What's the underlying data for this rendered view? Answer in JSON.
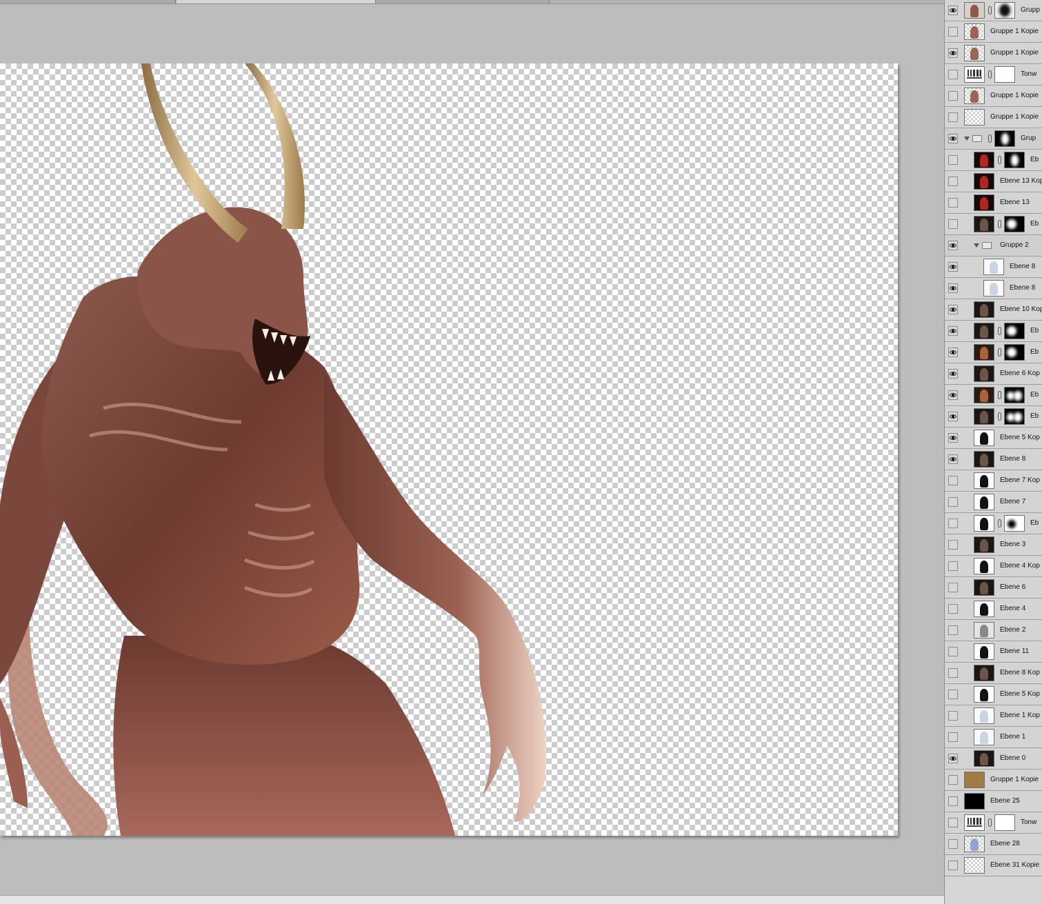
{
  "tabs": [
    {
      "label": "",
      "active": false
    },
    {
      "label": "",
      "active": true
    },
    {
      "label": "",
      "active": false
    }
  ],
  "layers": [
    {
      "name": "Grupp",
      "visible": true,
      "thumb": "creature",
      "mask": "dark",
      "indent": 0
    },
    {
      "name": "Gruppe 1 Kopie",
      "visible": false,
      "thumb": "creature-checker",
      "indent": 0
    },
    {
      "name": "Gruppe 1 Kopie",
      "visible": true,
      "thumb": "creature-checker",
      "indent": 0
    },
    {
      "name": "Tonw",
      "visible": false,
      "thumb": "levels",
      "mask": "white",
      "indent": 0
    },
    {
      "name": "Gruppe 1 Kopie",
      "visible": false,
      "thumb": "creature-checker",
      "indent": 0
    },
    {
      "name": "Gruppe 1 Kopie",
      "visible": false,
      "thumb": "checker",
      "indent": 0
    },
    {
      "name": "Grup",
      "visible": true,
      "group": true,
      "mask": "figure",
      "indent": 0
    },
    {
      "name": "Eb",
      "visible": false,
      "thumb": "red",
      "mask": "figure",
      "indent": 1
    },
    {
      "name": "Ebene 13 Kop",
      "visible": false,
      "thumb": "red",
      "indent": 1
    },
    {
      "name": "Ebene 13",
      "visible": false,
      "thumb": "red",
      "indent": 1
    },
    {
      "name": "Eb",
      "visible": false,
      "thumb": "dark",
      "mask": "blob",
      "indent": 1
    },
    {
      "name": "Gruppe 2",
      "visible": true,
      "group": true,
      "indent": 1
    },
    {
      "name": "Ebene 8",
      "visible": true,
      "thumb": "white-fig",
      "indent": 2
    },
    {
      "name": "Ebene 8",
      "visible": true,
      "thumb": "white-fig",
      "indent": 2
    },
    {
      "name": "Ebene 10 Kop",
      "visible": true,
      "thumb": "dark",
      "indent": 1
    },
    {
      "name": "Eb",
      "visible": true,
      "thumb": "dark",
      "mask": "blob",
      "indent": 1
    },
    {
      "name": "Eb",
      "visible": true,
      "thumb": "warm",
      "mask": "blob",
      "indent": 1
    },
    {
      "name": "Ebene 6 Kop",
      "visible": true,
      "thumb": "dark",
      "indent": 1
    },
    {
      "name": "Eb",
      "visible": true,
      "thumb": "warm",
      "mask": "blobs",
      "indent": 1
    },
    {
      "name": "Eb",
      "visible": true,
      "thumb": "dark",
      "mask": "blobs",
      "indent": 1
    },
    {
      "name": "Ebene 5 Kop",
      "visible": true,
      "thumb": "bw",
      "indent": 1
    },
    {
      "name": "Ebene 8",
      "visible": true,
      "thumb": "dark",
      "indent": 1
    },
    {
      "name": "Ebene 7 Kop",
      "visible": false,
      "thumb": "bw",
      "indent": 1
    },
    {
      "name": "Ebene 7",
      "visible": false,
      "thumb": "bw",
      "indent": 1
    },
    {
      "name": "Eb",
      "visible": false,
      "thumb": "bw",
      "mask": "blob-white",
      "indent": 1
    },
    {
      "name": "Ebene 3",
      "visible": false,
      "thumb": "dark",
      "indent": 1
    },
    {
      "name": "Ebene 4 Kop",
      "visible": false,
      "thumb": "bw",
      "indent": 1
    },
    {
      "name": "Ebene 6",
      "visible": false,
      "thumb": "dark",
      "indent": 1
    },
    {
      "name": "Ebene 4",
      "visible": false,
      "thumb": "bw",
      "indent": 1
    },
    {
      "name": "Ebene 2",
      "visible": false,
      "thumb": "gray",
      "indent": 1
    },
    {
      "name": "Ebene 11",
      "visible": false,
      "thumb": "bw",
      "indent": 1
    },
    {
      "name": "Ebene 8 Kop",
      "visible": false,
      "thumb": "dark",
      "indent": 1
    },
    {
      "name": "Ebene 5 Kop",
      "visible": false,
      "thumb": "bw",
      "indent": 1
    },
    {
      "name": "Ebene 1 Kop",
      "visible": false,
      "thumb": "white-fig",
      "indent": 1
    },
    {
      "name": "Ebene 1",
      "visible": false,
      "thumb": "white-fig",
      "indent": 1
    },
    {
      "name": "Ebene 0",
      "visible": true,
      "thumb": "dark",
      "indent": 1
    },
    {
      "name": "Gruppe 1 Kopie",
      "visible": false,
      "thumb": "tan",
      "indent": 0
    },
    {
      "name": "Ebene 25",
      "visible": false,
      "thumb": "black",
      "indent": 0
    },
    {
      "name": "Tonw",
      "visible": false,
      "thumb": "levels",
      "mask": "white",
      "indent": 0
    },
    {
      "name": "Ebene 28",
      "visible": false,
      "thumb": "bluish",
      "indent": 0
    },
    {
      "name": "Ebene 31 Kopie",
      "visible": false,
      "thumb": "checker",
      "indent": 0
    }
  ],
  "colors": {
    "workspace": "#bdbdbd",
    "panel": "#d6d6d6",
    "creature_skin": "#7a463c",
    "horn": "#cfb58a"
  }
}
